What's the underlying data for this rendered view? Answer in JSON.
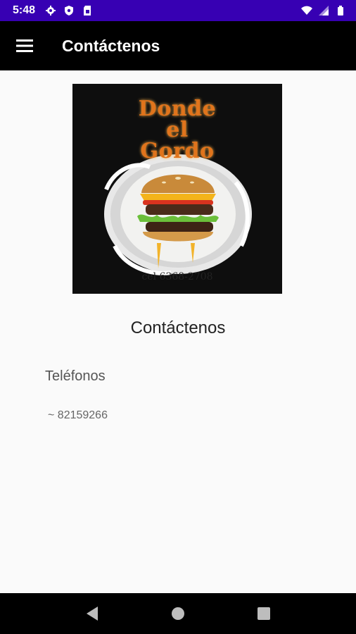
{
  "status_bar": {
    "time": "5:48",
    "icons_left": [
      "settings-icon",
      "shield-icon",
      "sim-card-icon"
    ],
    "icons_right": [
      "wifi-icon",
      "signal-icon",
      "battery-icon"
    ]
  },
  "toolbar": {
    "title": "Contáctenos",
    "menu_icon": "hamburger-menu-icon"
  },
  "logo": {
    "line1": "Donde",
    "line2": "el",
    "line3": "Gordo",
    "phone": "cel 6368-2708"
  },
  "main": {
    "heading": "Contáctenos",
    "phones_label": "Teléfonos",
    "phones": [
      "~ 82159266"
    ]
  },
  "nav_bar": {
    "buttons": [
      "back-icon",
      "home-icon",
      "recents-icon"
    ]
  },
  "colors": {
    "status_bar": "#3700b3",
    "toolbar": "#000000",
    "background": "#fafafa",
    "logo_text": "#e0741c"
  }
}
